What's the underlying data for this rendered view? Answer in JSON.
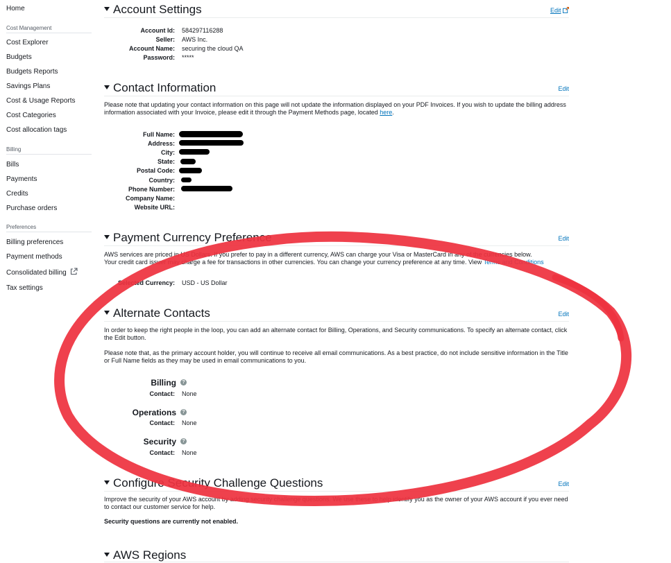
{
  "sidebar": {
    "home": "Home",
    "groups": [
      {
        "title": "Cost Management",
        "items": [
          "Cost Explorer",
          "Budgets",
          "Budgets Reports",
          "Savings Plans",
          "Cost & Usage Reports",
          "Cost Categories",
          "Cost allocation tags"
        ]
      },
      {
        "title": "Billing",
        "items": [
          "Bills",
          "Payments",
          "Credits",
          "Purchase orders"
        ]
      },
      {
        "title": "Preferences",
        "items": [
          "Billing preferences",
          "Payment methods",
          "Consolidated billing",
          "Tax settings"
        ]
      }
    ]
  },
  "account_settings": {
    "title": "Account Settings",
    "edit": "Edit",
    "fields": [
      {
        "label": "Account Id:",
        "value": "584297116288"
      },
      {
        "label": "Seller:",
        "value": "AWS Inc."
      },
      {
        "label": "Account Name:",
        "value": "securing the cloud QA"
      },
      {
        "label": "Password:",
        "value": "*****"
      }
    ]
  },
  "contact_information": {
    "title": "Contact Information",
    "edit": "Edit",
    "note_prefix": "Please note that updating your contact information on this page will not update the information displayed on your PDF Invoices. If you wish to update the billing address information associated with your Invoice, please edit it through the Payment Methods page, located ",
    "note_link": "here",
    "note_suffix": ".",
    "fields": [
      {
        "label": "Full Name:"
      },
      {
        "label": "Address:"
      },
      {
        "label": "City:"
      },
      {
        "label": "State:"
      },
      {
        "label": "Postal Code:"
      },
      {
        "label": "Country:"
      },
      {
        "label": "Phone Number:"
      },
      {
        "label": "Company Name:"
      },
      {
        "label": "Website URL:"
      }
    ]
  },
  "payment_currency": {
    "title": "Payment Currency Preference",
    "edit": "Edit",
    "text_line1": "AWS services are priced in US Dollars. If you prefer to pay in a different currency, AWS can charge your Visa or MasterCard in any of the currencies below.",
    "text_line2": "Your credit card issuer may charge a fee for transactions in other currencies. You can change your currency preference at any time. View",
    "terms_link": "Terms and Conditions",
    "selected_label": "Selected Currency:",
    "selected_value": "USD - US Dollar"
  },
  "alternate_contacts": {
    "title": "Alternate Contacts",
    "edit": "Edit",
    "intro": "In order to keep the right people in the loop, you can add an alternate contact for Billing, Operations, and Security communications. To specify an alternate contact, click the Edit button.",
    "note": "Please note that, as the primary account holder, you will continue to receive all email communications. As a best practice, do not include sensitive information in the Title or Full Name fields as they may be used in email communications to you.",
    "contacts": [
      {
        "title": "Billing",
        "label": "Contact:",
        "value": "None"
      },
      {
        "title": "Operations",
        "label": "Contact:",
        "value": "None"
      },
      {
        "title": "Security",
        "label": "Contact:",
        "value": "None"
      }
    ],
    "help_glyph": "?"
  },
  "security_questions": {
    "title": "Configure Security Challenge Questions",
    "edit": "Edit",
    "text": "Improve the security of your AWS account by adding security challenge questions. We use these to help identify you as the owner of your AWS account if you ever need to contact our customer service for help.",
    "status": "Security questions are currently not enabled."
  },
  "aws_regions": {
    "title": "AWS Regions"
  },
  "colors": {
    "link": "#0073bb",
    "annotation": "#ee3340",
    "redaction": "#000000"
  }
}
